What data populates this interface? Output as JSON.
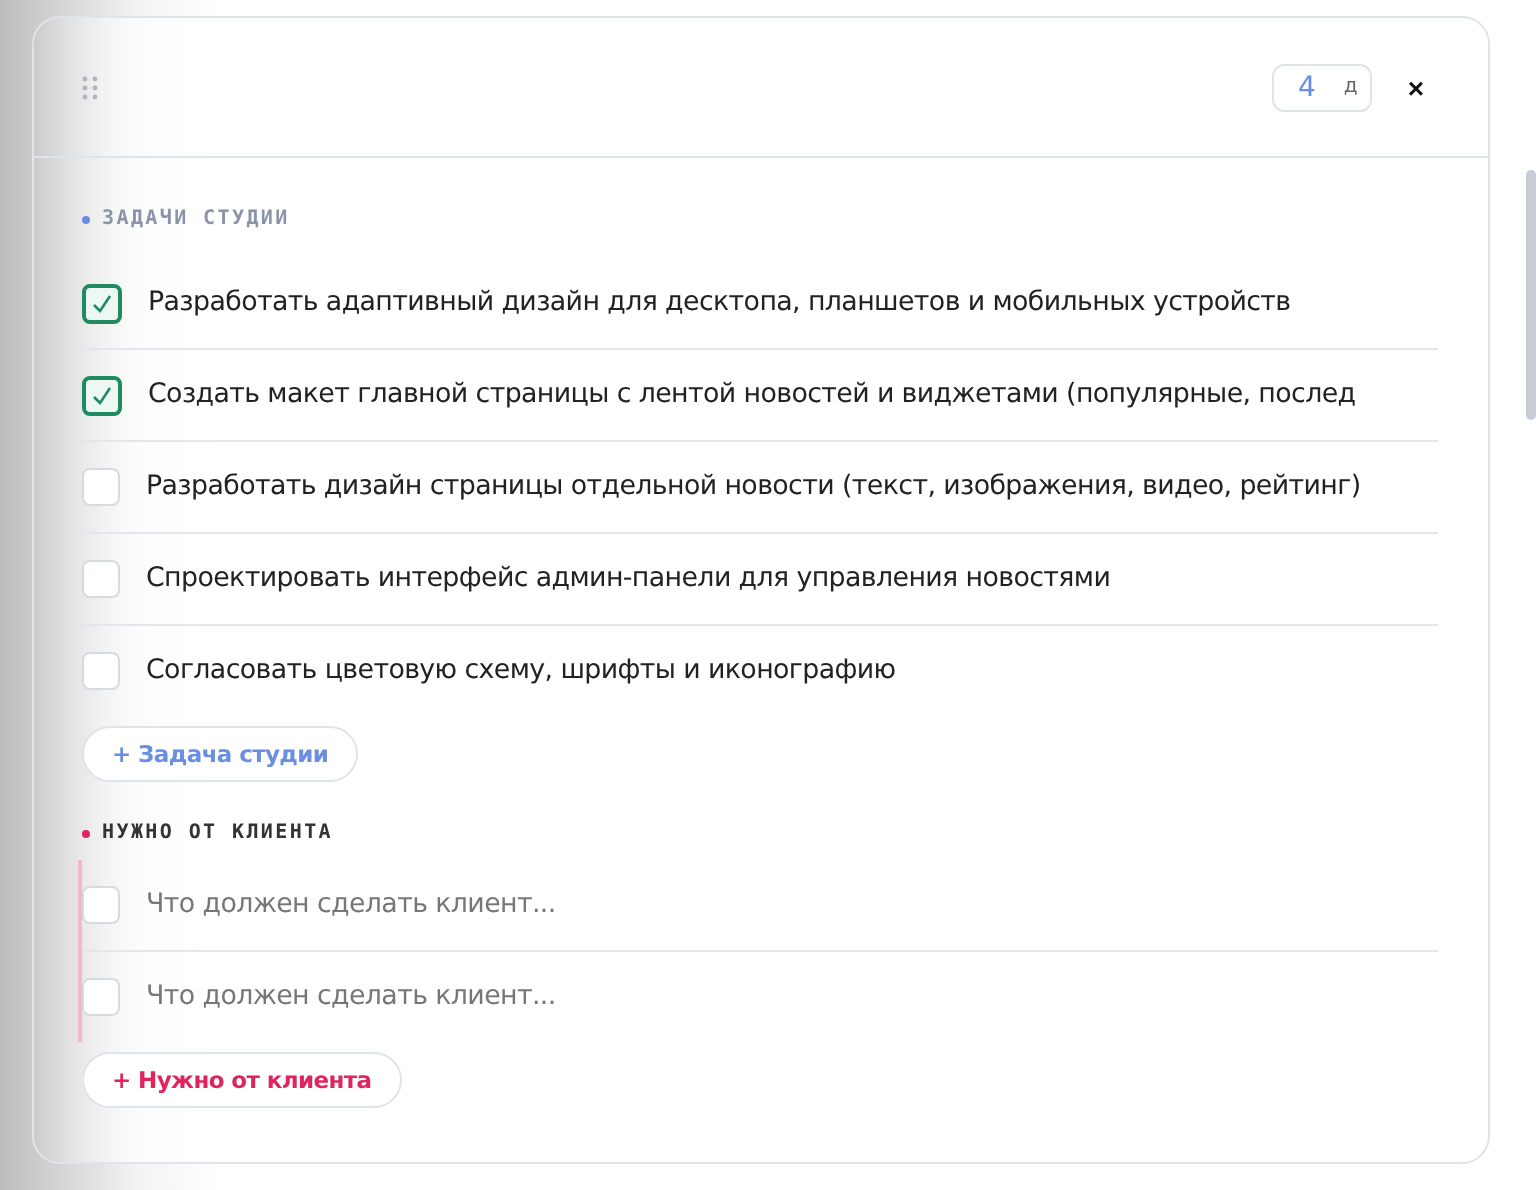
{
  "header": {
    "days": {
      "value": "4",
      "unit": "д"
    },
    "close": "×"
  },
  "sections": [
    {
      "title": "ЗАДАЧИ СТУДИИ",
      "color": "#6b8fe0",
      "kind": "studio",
      "tasks": [
        {
          "kind": "task",
          "text": "Разработать адаптивный дизайн для десктопа, планшетов и мобильных устройств",
          "checked": true
        },
        {
          "kind": "task",
          "text": "Создать макет главной страницы с лентой новостей и виджетами (популярные, послед",
          "checked": true
        },
        {
          "kind": "task",
          "text": "Разработать дизайн страницы отдельной новости (текст, изображения, видео, рейтинг)",
          "checked": false
        },
        {
          "kind": "task",
          "text": "Спроектировать интерфейс админ-панели для управления новостями",
          "checked": false
        },
        {
          "kind": "task",
          "text": "Согласовать цветовую схему, шрифты и иконографию",
          "checked": false
        }
      ],
      "add_button": "+ Задача студии"
    },
    {
      "title": "НУЖНО ОТ КЛИЕНТА",
      "color": "#e0245e",
      "kind": "client",
      "tasks": [
        {
          "kind": "input",
          "placeholder": "Что должен сделать клиент...",
          "checked": false
        },
        {
          "kind": "input",
          "placeholder": "Что должен сделать клиент...",
          "checked": false
        }
      ],
      "add_button": "+ Нужно от клиента"
    }
  ]
}
